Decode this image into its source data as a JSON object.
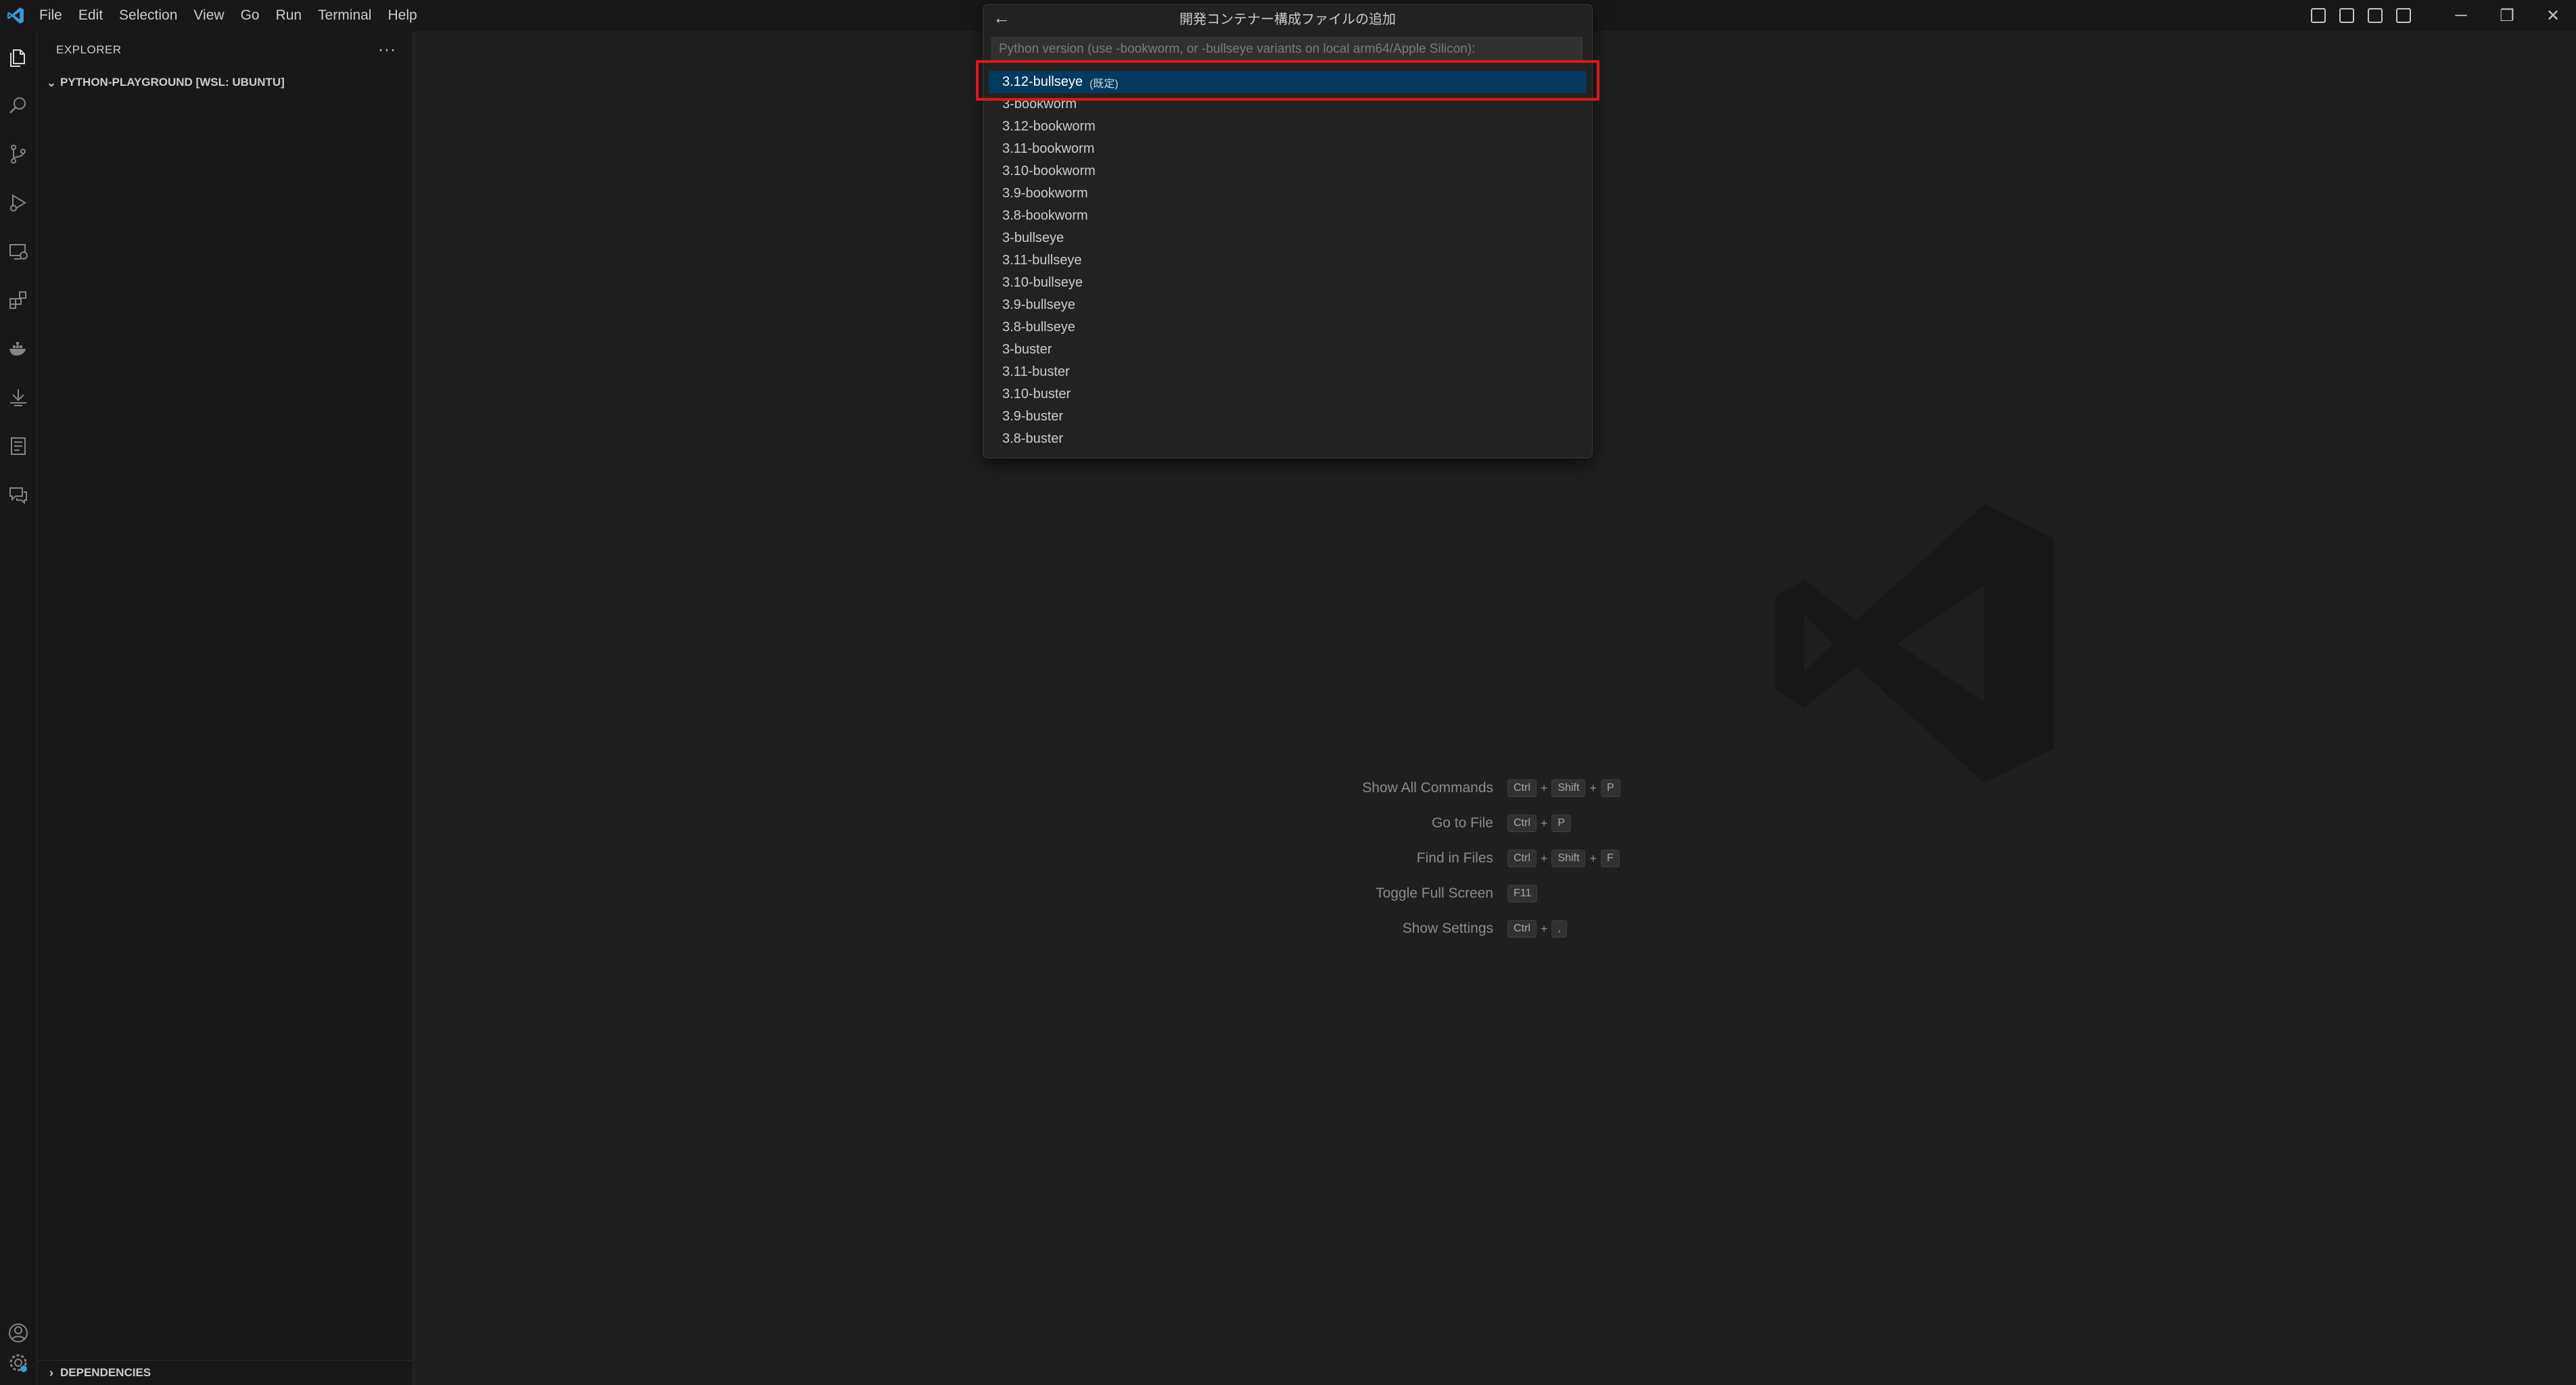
{
  "menu": [
    "File",
    "Edit",
    "Selection",
    "View",
    "Go",
    "Run",
    "Terminal",
    "Help"
  ],
  "sidebar": {
    "title": "EXPLORER",
    "more": "···",
    "folder": "PYTHON-PLAYGROUND [WSL: UBUNTU]",
    "bottom_section": "DEPENDENCIES"
  },
  "quickpick": {
    "title": "開発コンテナー構成ファイルの追加",
    "placeholder": "Python version (use -bookworm, or -bullseye variants on local arm64/Apple Silicon):",
    "selected_desc": "(既定)",
    "items": [
      "3.12-bullseye",
      "3-bookworm",
      "3.12-bookworm",
      "3.11-bookworm",
      "3.10-bookworm",
      "3.9-bookworm",
      "3.8-bookworm",
      "3-bullseye",
      "3.11-bullseye",
      "3.10-bullseye",
      "3.9-bullseye",
      "3.8-bullseye",
      "3-buster",
      "3.11-buster",
      "3.10-buster",
      "3.9-buster",
      "3.8-buster"
    ]
  },
  "shortcuts": [
    {
      "label": "Show All Commands",
      "keys": [
        "Ctrl",
        "Shift",
        "P"
      ]
    },
    {
      "label": "Go to File",
      "keys": [
        "Ctrl",
        "P"
      ]
    },
    {
      "label": "Find in Files",
      "keys": [
        "Ctrl",
        "Shift",
        "F"
      ]
    },
    {
      "label": "Toggle Full Screen",
      "keys": [
        "F11"
      ]
    },
    {
      "label": "Show Settings",
      "keys": [
        "Ctrl",
        ","
      ]
    }
  ],
  "activity_icons": [
    "explorer-icon",
    "search-icon",
    "source-control-icon",
    "run-debug-icon",
    "remote-explorer-icon",
    "extensions-icon",
    "docker-icon",
    "deploy-icon",
    "notebook-icon",
    "chat-icon",
    "account-icon",
    "settings-gear-icon"
  ],
  "colors": {
    "selection": "#04395e",
    "highlight": "#e0151b",
    "brand": "#3c99d4"
  }
}
